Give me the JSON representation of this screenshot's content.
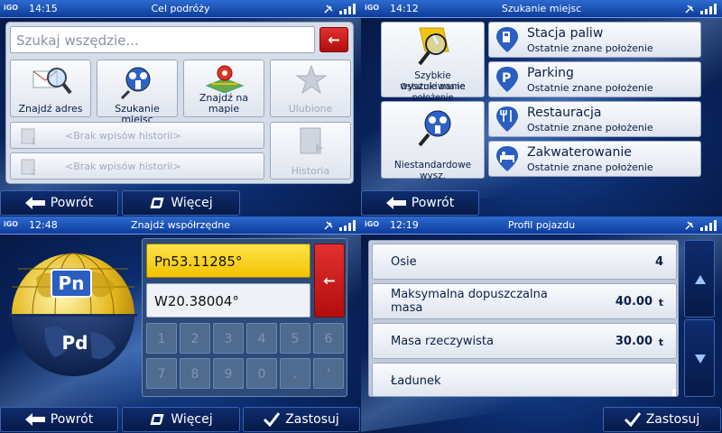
{
  "q1": {
    "time": "14:15",
    "title": "Cel podróży",
    "search_placeholder": "Szukaj wszędzie...",
    "tiles": [
      {
        "label": "Znajdź adres"
      },
      {
        "label": "Szukanie miejsc"
      },
      {
        "label": "Znajdź na mapie"
      },
      {
        "label": "Ulubione"
      }
    ],
    "history": [
      "<Brak wpisów historii>",
      "<Brak wpisów historii>"
    ],
    "history_button": "Historia",
    "back": "Powrót",
    "more": "Więcej"
  },
  "q2": {
    "time": "14:12",
    "title": "Szukanie miejsc",
    "left_tiles": [
      {
        "title": "Szybkie wyszukiwanie",
        "sub": "Ostatnie znane położenie"
      },
      {
        "title": "Niestandardowe wysz."
      }
    ],
    "items": [
      {
        "name": "Stacja paliw",
        "sub": "Ostatnie znane położenie"
      },
      {
        "name": "Parking",
        "sub": "Ostatnie znane położenie"
      },
      {
        "name": "Restauracja",
        "sub": "Ostatnie znane położenie"
      },
      {
        "name": "Zakwaterowanie",
        "sub": "Ostatnie znane położenie"
      }
    ],
    "back": "Powrót"
  },
  "q3": {
    "time": "12:48",
    "title": "Znajdź współrzędne",
    "globe_top": "Pn",
    "globe_bottom": "Pd",
    "lat": "Pn53.11285°",
    "lon": "W20.38004°",
    "keys": [
      "1",
      "2",
      "3",
      "4",
      "5",
      "6",
      "7",
      "8",
      "9",
      "0",
      ".",
      "'"
    ],
    "back": "Powrót",
    "more": "Więcej",
    "apply": "Zastosuj"
  },
  "q4": {
    "time": "12:19",
    "title": "Profil pojazdu",
    "rows": [
      {
        "label": "Osie",
        "value": "4",
        "unit": ""
      },
      {
        "label": "Maksymalna dopuszczalna masa",
        "value": "40.00",
        "unit": "t"
      },
      {
        "label": "Masa rzeczywista",
        "value": "30.00",
        "unit": "t"
      },
      {
        "label": "Ładunek",
        "value": "",
        "unit": ""
      }
    ],
    "apply": "Zastosuj"
  },
  "logo": "iGO"
}
